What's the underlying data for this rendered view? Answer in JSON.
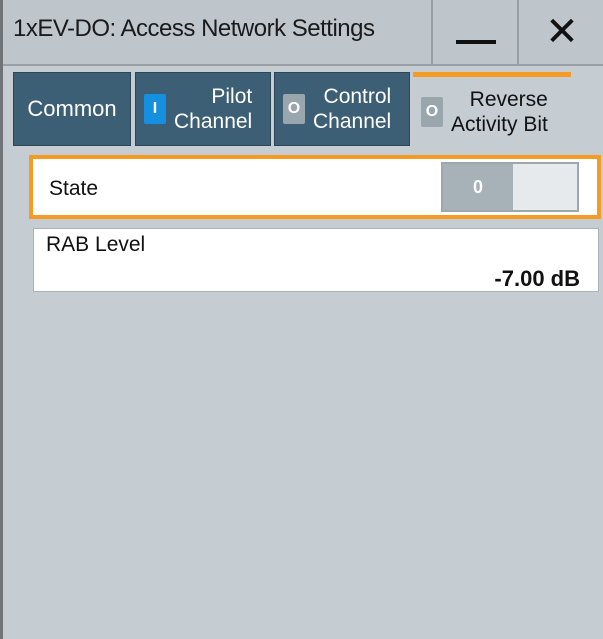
{
  "window": {
    "title": "1xEV-DO: Access Network Settings",
    "minimize_icon": "minimize-icon",
    "close_icon": "close-icon",
    "close_glyph": "✕"
  },
  "tabs": [
    {
      "label_line1": "Common",
      "label_line2": "",
      "toggle": null,
      "active": false
    },
    {
      "label_line1": "Pilot",
      "label_line2": "Channel",
      "toggle": "I",
      "active": false
    },
    {
      "label_line1": "Control",
      "label_line2": "Channel",
      "toggle": "O",
      "active": false
    },
    {
      "label_line1": "Reverse",
      "label_line2": "Activity Bit",
      "toggle": "O",
      "active": true
    }
  ],
  "state": {
    "label": "State",
    "toggle_value": "0"
  },
  "rab_level": {
    "label": "RAB Level",
    "value": "-7.00 dB"
  },
  "colors": {
    "accent": "#f59a23",
    "tab_bg": "#3d5f75",
    "panel_bg": "#c5cdd2",
    "led_on": "#1590e0"
  }
}
